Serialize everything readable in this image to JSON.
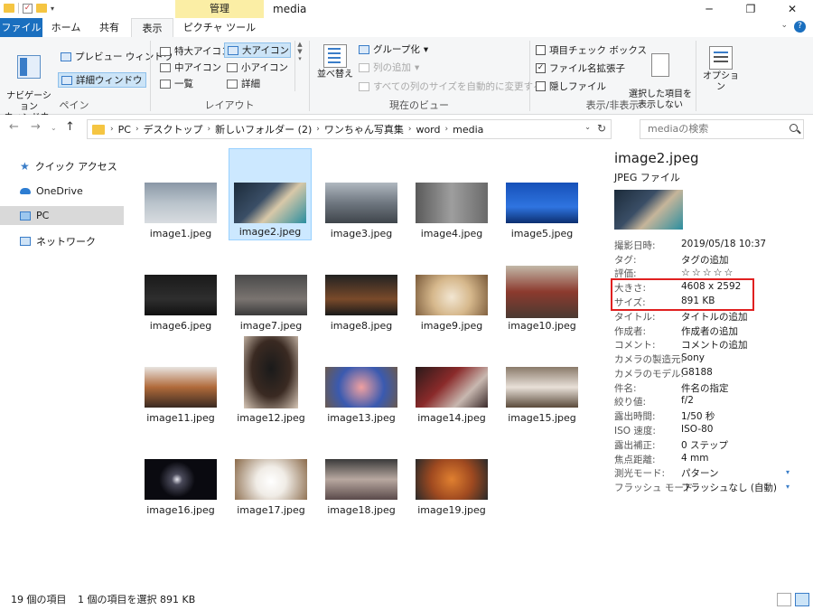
{
  "window": {
    "title": "media",
    "context_group": "管理",
    "buttons": [
      "─",
      "❐",
      "✕"
    ]
  },
  "tabs": [
    {
      "label": "ファイル"
    },
    {
      "label": "ホーム"
    },
    {
      "label": "共有"
    },
    {
      "label": "表示"
    },
    {
      "label": "ピクチャ ツール"
    }
  ],
  "ribbon": {
    "pane": {
      "nav_pane": "ナビゲーション\nウィンドウ▾",
      "preview": "プレビュー ウィンドウ",
      "details": "詳細ウィンドウ",
      "label": "ペイン"
    },
    "layout": {
      "items": [
        "特大アイコン",
        "大アイコン",
        "中アイコン",
        "小アイコン",
        "一覧",
        "詳細"
      ],
      "label": "レイアウト"
    },
    "current_view": {
      "sort": "並べ替え",
      "group": "グループ化",
      "add_col": "列の追加",
      "fit_cols": "すべての列のサイズを自動的に変更する",
      "label": "現在のビュー"
    },
    "show_hide": {
      "checkboxes": "項目チェック ボックス",
      "extensions": "ファイル名拡張子",
      "hidden": "隠しファイル",
      "hide_selected": "選択した項目を\n表示しない",
      "label": "表示/非表示"
    },
    "options": "オプション"
  },
  "address": {
    "crumbs": [
      "PC",
      "デスクトップ",
      "新しいフォルダー (2)",
      "ワンちゃん写真集",
      "word",
      "media"
    ],
    "search_placeholder": "mediaの検索"
  },
  "nav_pane": [
    {
      "label": "クイック アクセス",
      "icon": "star-icon"
    },
    {
      "label": "OneDrive",
      "icon": "cloud-icon"
    },
    {
      "label": "PC",
      "icon": "pc-icon",
      "selected": true
    },
    {
      "label": "ネットワーク",
      "icon": "network-icon"
    }
  ],
  "files": [
    {
      "name": "image1.jpeg"
    },
    {
      "name": "image2.jpeg"
    },
    {
      "name": "image3.jpeg"
    },
    {
      "name": "image4.jpeg"
    },
    {
      "name": "image5.jpeg"
    },
    {
      "name": "image6.jpeg"
    },
    {
      "name": "image7.jpeg"
    },
    {
      "name": "image8.jpeg"
    },
    {
      "name": "image9.jpeg"
    },
    {
      "name": "image10.jpeg"
    },
    {
      "name": "image11.jpeg"
    },
    {
      "name": "image12.jpeg"
    },
    {
      "name": "image13.jpeg"
    },
    {
      "name": "image14.jpeg"
    },
    {
      "name": "image15.jpeg"
    },
    {
      "name": "image16.jpeg"
    },
    {
      "name": "image17.jpeg"
    },
    {
      "name": "image18.jpeg"
    },
    {
      "name": "image19.jpeg"
    }
  ],
  "details": {
    "name": "image2.jpeg",
    "type": "JPEG ファイル",
    "props": [
      {
        "k": "撮影日時:",
        "v": "2019/05/18 10:37"
      },
      {
        "k": "タグ:",
        "v": "タグの追加"
      },
      {
        "k": "評価:",
        "v": "☆☆☆☆☆"
      },
      {
        "k": "大きさ:",
        "v": "4608 x 2592"
      },
      {
        "k": "サイズ:",
        "v": "891 KB"
      },
      {
        "k": "タイトル:",
        "v": "タイトルの追加"
      },
      {
        "k": "作成者:",
        "v": "作成者の追加"
      },
      {
        "k": "コメント:",
        "v": "コメントの追加"
      },
      {
        "k": "カメラの製造元:",
        "v": "Sony"
      },
      {
        "k": "カメラのモデル:",
        "v": "G8188"
      },
      {
        "k": "件名:",
        "v": "件名の指定"
      },
      {
        "k": "絞り値:",
        "v": "f/2"
      },
      {
        "k": "露出時間:",
        "v": "1/50 秒"
      },
      {
        "k": "ISO 速度:",
        "v": "ISO-80"
      },
      {
        "k": "露出補正:",
        "v": "0 ステップ"
      },
      {
        "k": "焦点距離:",
        "v": "4 mm"
      },
      {
        "k": "測光モード:",
        "v": "パターン"
      },
      {
        "k": "フラッシュ モード:",
        "v": "フラッシュなし (自動)"
      }
    ]
  },
  "status": {
    "count": "19 個の項目",
    "selection": "1 個の項目を選択  891 KB"
  },
  "colors": {
    "accent": "#1a6fbf",
    "highlight_box": "#e02020",
    "selection": "#cce8ff"
  }
}
